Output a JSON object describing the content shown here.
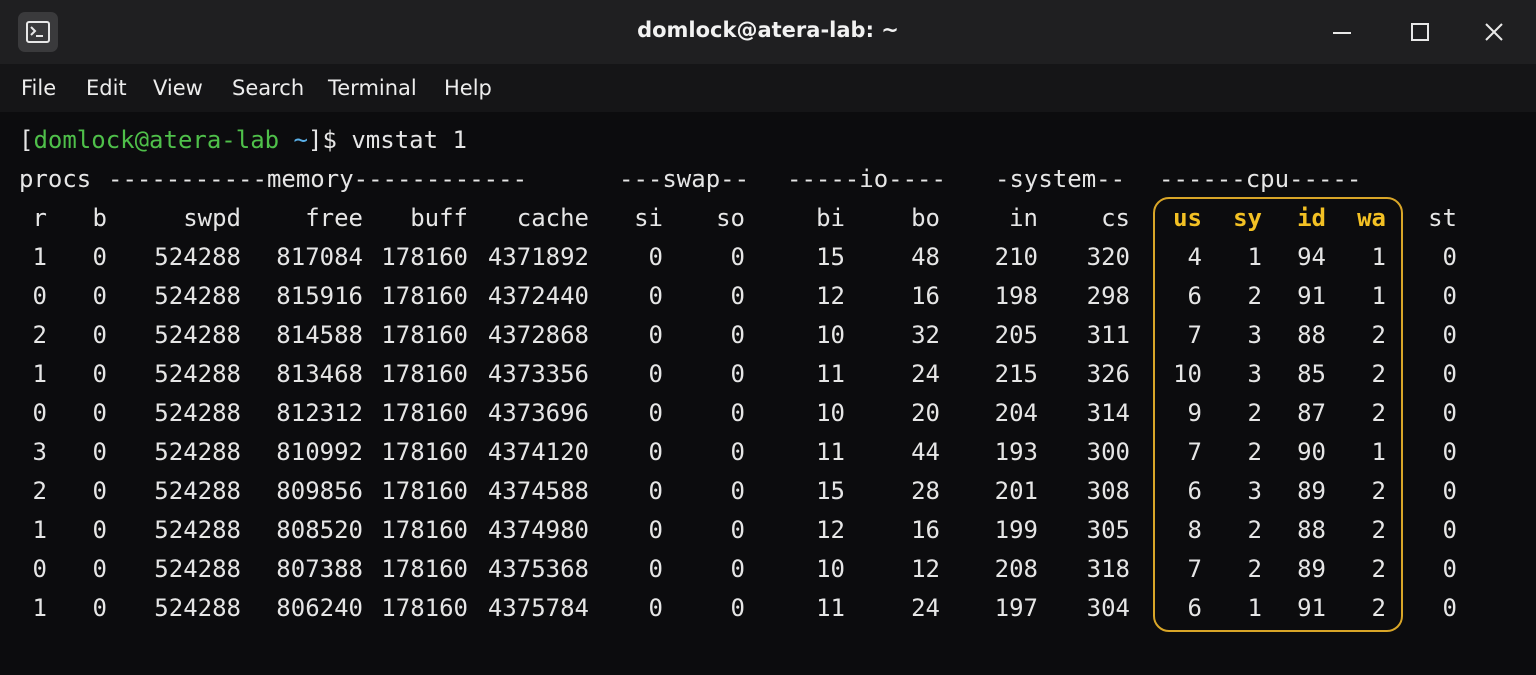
{
  "window": {
    "title": "domlock@atera-lab: ~",
    "icon": "terminal-icon"
  },
  "menu": [
    "File",
    "Edit",
    "View",
    "Search",
    "Terminal",
    "Help"
  ],
  "prompt": {
    "open": "[",
    "user_host": "domlock@atera-lab",
    "cwd": "~",
    "close": "]$",
    "command": "vmstat 1"
  },
  "group_headers": {
    "procs": "procs",
    "memory": "-----------memory------------",
    "swap": "---swap--",
    "io": "-----io----",
    "system": "-system--",
    "cpu": "------cpu-----"
  },
  "columns": [
    "r",
    "b",
    "swpd",
    "free",
    "buff",
    "cache",
    "si",
    "so",
    "bi",
    "bo",
    "in",
    "cs",
    "us",
    "sy",
    "id",
    "wa",
    "st"
  ],
  "rows": [
    [
      "1",
      "0",
      "524288",
      "817084",
      "178160",
      "4371892",
      "0",
      "0",
      "15",
      "48",
      "210",
      "320",
      "4",
      "1",
      "94",
      "1",
      "0"
    ],
    [
      "0",
      "0",
      "524288",
      "815916",
      "178160",
      "4372440",
      "0",
      "0",
      "12",
      "16",
      "198",
      "298",
      "6",
      "2",
      "91",
      "1",
      "0"
    ],
    [
      "2",
      "0",
      "524288",
      "814588",
      "178160",
      "4372868",
      "0",
      "0",
      "10",
      "32",
      "205",
      "311",
      "7",
      "3",
      "88",
      "2",
      "0"
    ],
    [
      "1",
      "0",
      "524288",
      "813468",
      "178160",
      "4373356",
      "0",
      "0",
      "11",
      "24",
      "215",
      "326",
      "10",
      "3",
      "85",
      "2",
      "0"
    ],
    [
      "0",
      "0",
      "524288",
      "812312",
      "178160",
      "4373696",
      "0",
      "0",
      "10",
      "20",
      "204",
      "314",
      "9",
      "2",
      "87",
      "2",
      "0"
    ],
    [
      "3",
      "0",
      "524288",
      "810992",
      "178160",
      "4374120",
      "0",
      "0",
      "11",
      "44",
      "193",
      "300",
      "7",
      "2",
      "90",
      "1",
      "0"
    ],
    [
      "2",
      "0",
      "524288",
      "809856",
      "178160",
      "4374588",
      "0",
      "0",
      "15",
      "28",
      "201",
      "308",
      "6",
      "3",
      "89",
      "2",
      "0"
    ],
    [
      "1",
      "0",
      "524288",
      "808520",
      "178160",
      "4374980",
      "0",
      "0",
      "12",
      "16",
      "199",
      "305",
      "8",
      "2",
      "88",
      "2",
      "0"
    ],
    [
      "0",
      "0",
      "524288",
      "807388",
      "178160",
      "4375368",
      "0",
      "0",
      "10",
      "12",
      "208",
      "318",
      "7",
      "2",
      "89",
      "2",
      "0"
    ],
    [
      "1",
      "0",
      "524288",
      "806240",
      "178160",
      "4375784",
      "0",
      "0",
      "11",
      "24",
      "197",
      "304",
      "6",
      "1",
      "91",
      "2",
      "0"
    ]
  ],
  "highlight": {
    "columns": [
      "us",
      "sy",
      "id",
      "wa"
    ],
    "color": "#f3c124",
    "border_color": "#d9a628"
  },
  "colors": {
    "prompt_user": "#4fc04a",
    "prompt_cwd": "#5ab0e8",
    "text": "#e6e6e6",
    "background": "#0c0c0e"
  }
}
